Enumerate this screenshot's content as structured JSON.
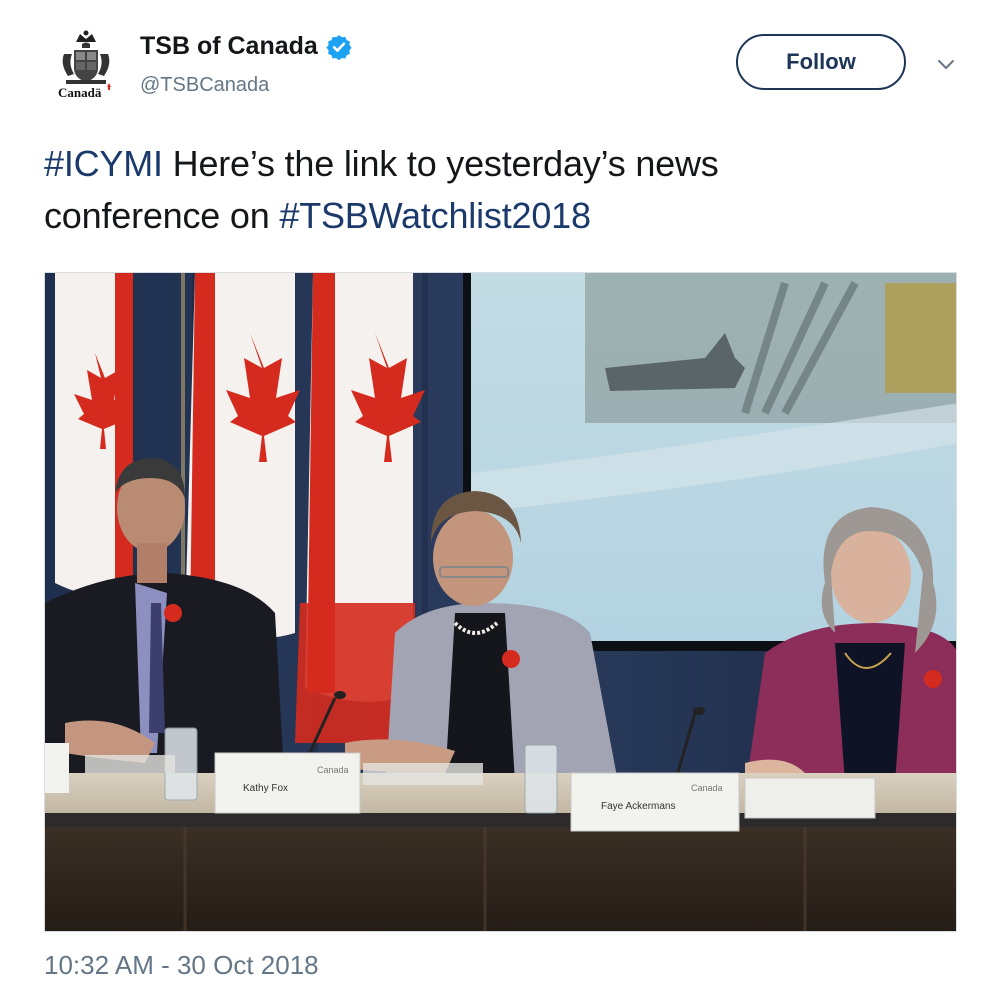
{
  "account": {
    "display_name": "TSB of Canada",
    "handle": "@TSBCanada",
    "verified": true,
    "logo_wordmark": "Canadä"
  },
  "follow": {
    "label": "Follow"
  },
  "more_menu": {
    "icon": "chevron-down-icon"
  },
  "tweet": {
    "text_1": "Here’s the link to  yesterday’s news",
    "text_2": "conference on ",
    "hashtags": [
      "#ICYMI",
      "#TSBWatchlist2018"
    ]
  },
  "media": {
    "nameplates": [
      {
        "name": "Kathy Fox",
        "brand": "Canada"
      },
      {
        "name": "Faye Ackermans",
        "brand": "Canada"
      }
    ]
  },
  "timestamp": "10:32 AM - 30 Oct 2018",
  "colors": {
    "hashtag": "#1b3a6b",
    "follow_border": "#1d3557",
    "secondary_text": "#657786",
    "verified": "#1da1f2",
    "flag_red": "#d52b1e"
  }
}
